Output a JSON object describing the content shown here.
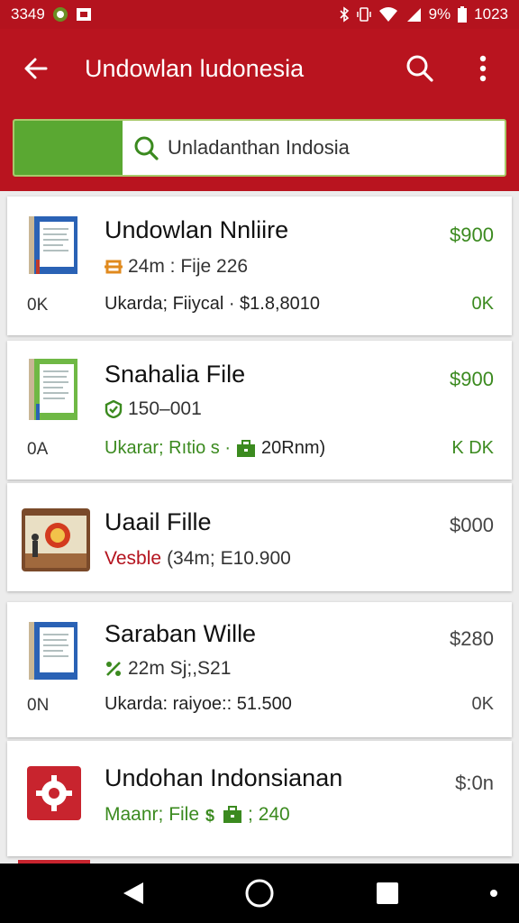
{
  "status_bar": {
    "time": "3349",
    "battery_text": "9%",
    "clock_right": "1023"
  },
  "app_bar": {
    "title": "Undowlan ludonesia",
    "back_icon": "arrow-left-icon",
    "search_icon": "search-icon",
    "menu_icon": "more-vert-icon"
  },
  "search": {
    "value": "Unladanthan Indosia"
  },
  "items": [
    {
      "title": "Undowlan Nnliire",
      "price": "$900",
      "sub": "24m : Fije 226",
      "left": "0K",
      "meta": "Ukarda; Fiiycal · $1.8,8010",
      "right": "0K"
    },
    {
      "title": "Snahalia File",
      "price": "$900",
      "sub": "150–001",
      "left": "0A",
      "meta_a": "Ukarar; Rıtio s ·",
      "meta_b": "20Rnm)",
      "right": "K DK"
    },
    {
      "title": "Uaail Fille",
      "price": "$000",
      "sub_a": "Vesble",
      "sub_b": "(34m; E10.900"
    },
    {
      "title": "Saraban Wille",
      "price": "$280",
      "sub": "22m Sj;,S21",
      "left": "0N",
      "meta": "Ukarda: raiyoe:: 51.500",
      "right": "0K"
    },
    {
      "title": "Undohan Indonsianan",
      "price": "$:0n",
      "sub_a": "Maanr; File",
      "sub_b": "; 240"
    }
  ],
  "colors": {
    "brand": "#b9141f",
    "accent_green": "#5aa832"
  }
}
